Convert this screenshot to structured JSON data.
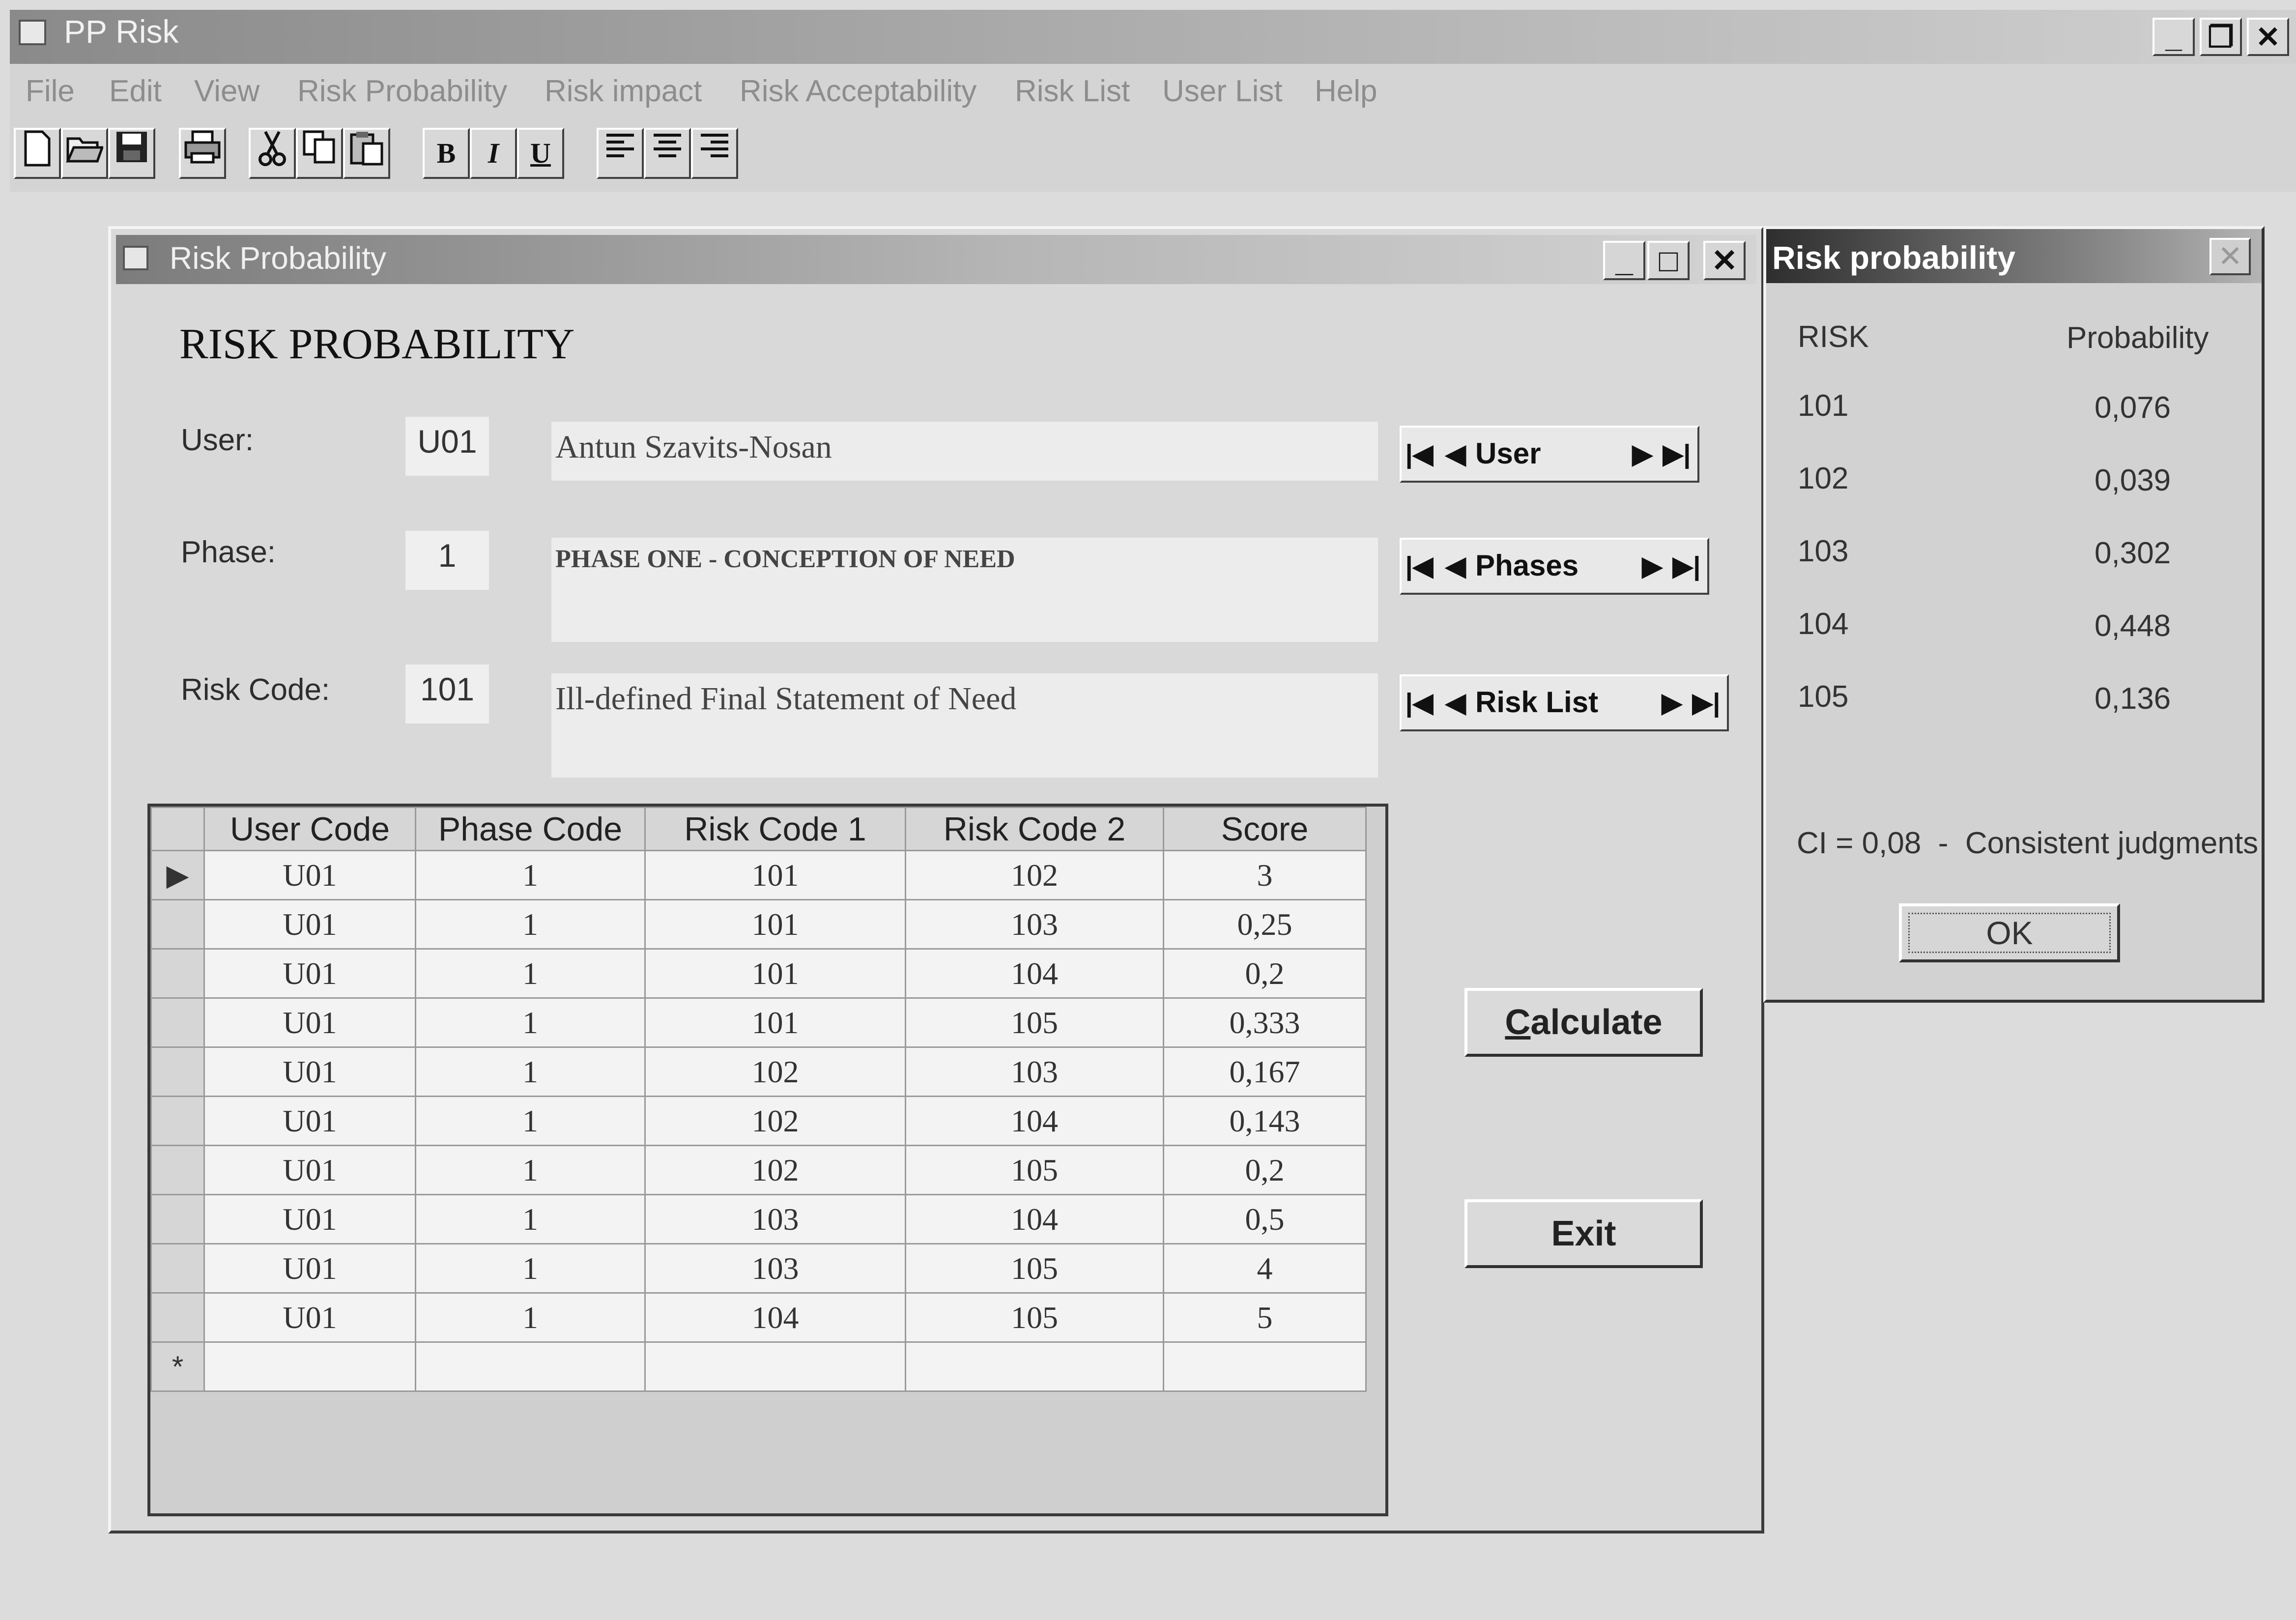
{
  "app": {
    "title": "PP Risk",
    "controls": {
      "minimize": "_",
      "restore": "❐",
      "close": "✕"
    }
  },
  "menu": [
    "File",
    "Edit",
    "View",
    "Risk Probability",
    "Risk impact",
    "Risk Acceptability",
    "Risk List",
    "User List",
    "Help"
  ],
  "toolbar": {
    "icons": [
      "new-icon",
      "open-icon",
      "save-icon",
      "print-icon",
      "cut-icon",
      "copy-icon",
      "paste-icon",
      "bold-icon",
      "italic-icon",
      "underline-icon",
      "align-left-icon",
      "align-center-icon",
      "align-right-icon"
    ],
    "bold": "B",
    "italic": "I",
    "underline": "U"
  },
  "child_window": {
    "title": "Risk Probability",
    "heading": "RISK PROBABILITY",
    "user": {
      "label": "User:",
      "code": "U01",
      "description": "Antun Szavits-Nosan",
      "nav_label": "User"
    },
    "phase": {
      "label": "Phase:",
      "code": "1",
      "description": "PHASE ONE - CONCEPTION OF NEED",
      "nav_label": "Phases"
    },
    "risk": {
      "label": "Risk Code:",
      "code": "101",
      "description": "Ill-defined Final Statement of Need",
      "nav_label": "Risk List"
    },
    "grid": {
      "columns": [
        "User Code",
        "Phase Code",
        "Risk Code 1",
        "Risk Code 2",
        "Score"
      ],
      "rows": [
        [
          "U01",
          "1",
          "101",
          "102",
          "3"
        ],
        [
          "U01",
          "1",
          "101",
          "103",
          "0,25"
        ],
        [
          "U01",
          "1",
          "101",
          "104",
          "0,2"
        ],
        [
          "U01",
          "1",
          "101",
          "105",
          "0,333"
        ],
        [
          "U01",
          "1",
          "102",
          "103",
          "0,167"
        ],
        [
          "U01",
          "1",
          "102",
          "104",
          "0,143"
        ],
        [
          "U01",
          "1",
          "102",
          "105",
          "0,2"
        ],
        [
          "U01",
          "1",
          "103",
          "104",
          "0,5"
        ],
        [
          "U01",
          "1",
          "103",
          "105",
          "4"
        ],
        [
          "U01",
          "1",
          "104",
          "105",
          "5"
        ]
      ],
      "current_row_marker": "▶",
      "new_row_marker": "*"
    },
    "calculate_button": "Calculate",
    "exit_button": "Exit"
  },
  "dialog": {
    "title": "Risk probability",
    "col_risk": "RISK",
    "col_probability": "Probability",
    "rows": [
      {
        "risk": "101",
        "probability": "0,076"
      },
      {
        "risk": "102",
        "probability": "0,039"
      },
      {
        "risk": "103",
        "probability": "0,302"
      },
      {
        "risk": "104",
        "probability": "0,448"
      },
      {
        "risk": "105",
        "probability": "0,136"
      }
    ],
    "consistency": "CI = 0,08  -  Consistent judgments",
    "ok": "OK",
    "close": "✕"
  }
}
